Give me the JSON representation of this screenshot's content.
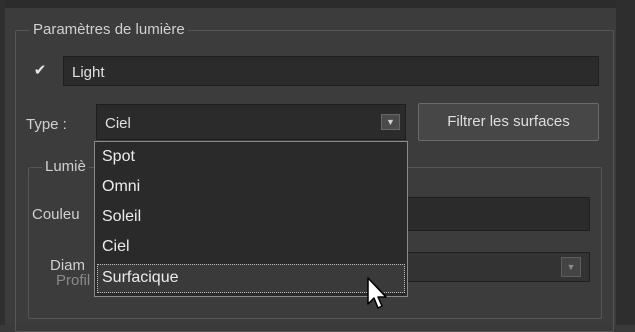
{
  "group": {
    "title": "Paramètres de lumière"
  },
  "light": {
    "checked_icon": "checkmark-icon",
    "name": "Light"
  },
  "type_row": {
    "label": "Type :",
    "selected": "Ciel",
    "filter_button": "Filtrer les surfaces"
  },
  "sub_group": {
    "title_visible": "Lumiè"
  },
  "color_label_visible": "Couleu",
  "diameter_label_visible": "Diam",
  "ies_label_visible": "Profil d'éclairage IES",
  "dropdown": {
    "options": [
      "Spot",
      "Omni",
      "Soleil",
      "Ciel",
      "Surfacique"
    ],
    "highlighted": "Surfacique"
  }
}
